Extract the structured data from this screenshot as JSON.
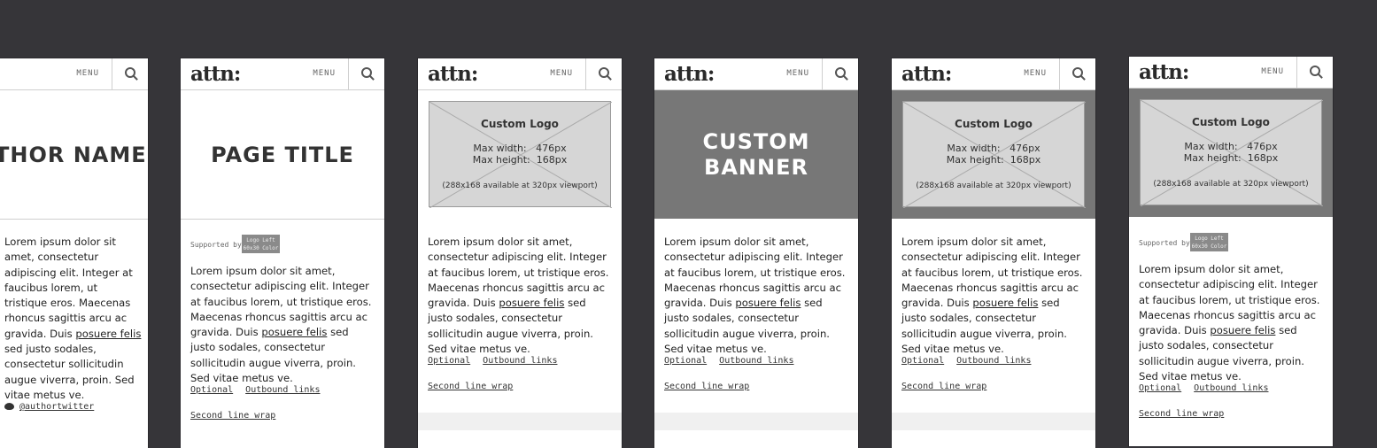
{
  "nav": {
    "logo": "attn:",
    "menu_label": "MENU"
  },
  "author_card": {
    "title": "THOR NAME",
    "twitter": "@authortwitter"
  },
  "page_title_card": {
    "title": "PAGE TITLE"
  },
  "banner": {
    "line1": "CUSTOM",
    "line2": "BANNER"
  },
  "placeholder": {
    "title": "Custom Logo",
    "dims": "Max width:   476px\nMax height:  168px",
    "note": "(288x168 available at 320px viewport)"
  },
  "supported": {
    "label": "Supported by",
    "box_line1": "Logo Left",
    "box_line2": "60x30 Color"
  },
  "text": {
    "before_link": "Lorem ipsum dolor sit amet, consectetur adipiscing elit. Integer at faucibus lorem, ut tristique eros. Maecenas rhoncus sagittis arcu ac gravida. Duis ",
    "link": "posuere felis",
    "after_link": " sed justo sodales, consectetur sollicitudin augue viverra, proin. Sed vitae metus ve."
  },
  "links": {
    "optional": "Optional",
    "outbound": "Outbound links",
    "second": "Second line wrap"
  }
}
